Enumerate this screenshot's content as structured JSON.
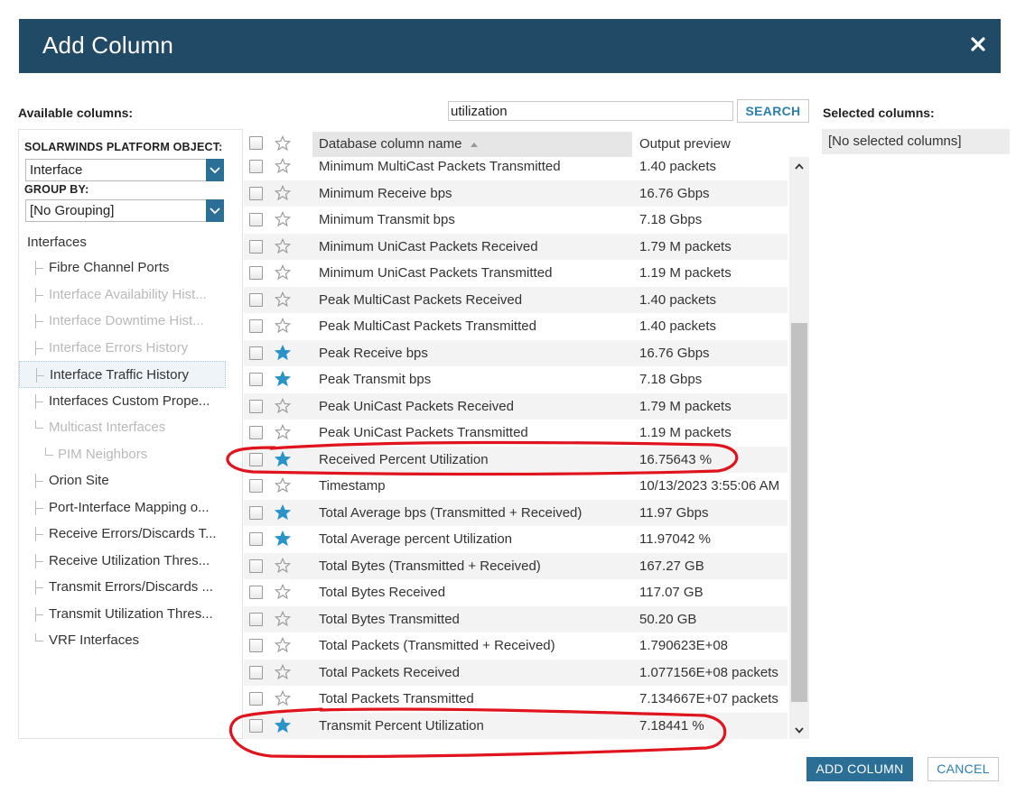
{
  "dialog": {
    "title": "Add Column",
    "close_icon": "close-icon"
  },
  "labels": {
    "available_columns": "Available columns:",
    "selected_columns": "Selected columns:",
    "platform_object": "SOLARWINDS PLATFORM OBJECT:",
    "group_by": "GROUP BY:"
  },
  "search": {
    "value": "utilization",
    "button_label": "SEARCH"
  },
  "selects": {
    "platform_object_value": "Interface",
    "group_by_value": "[No Grouping]"
  },
  "tree": {
    "root": "Interfaces",
    "items": [
      {
        "label": "Fibre Channel Ports",
        "dim": false
      },
      {
        "label": "Interface Availability Hist...",
        "dim": true
      },
      {
        "label": "Interface Downtime Hist...",
        "dim": true
      },
      {
        "label": "Interface Errors History",
        "dim": true
      },
      {
        "label": "Interface Traffic History",
        "dim": false,
        "selected": true
      },
      {
        "label": "Interfaces Custom Prope...",
        "dim": false
      },
      {
        "label": "Multicast Interfaces",
        "dim": true
      },
      {
        "label": "PIM Neighbors",
        "dim": true,
        "deep": true
      },
      {
        "label": "Orion Site",
        "dim": false
      },
      {
        "label": "Port-Interface Mapping o...",
        "dim": false
      },
      {
        "label": "Receive Errors/Discards T...",
        "dim": false
      },
      {
        "label": "Receive Utilization Thres...",
        "dim": false
      },
      {
        "label": "Transmit Errors/Discards ...",
        "dim": false
      },
      {
        "label": "Transmit Utilization Thres...",
        "dim": false
      },
      {
        "label": "VRF Interfaces",
        "dim": false
      }
    ]
  },
  "grid": {
    "headers": {
      "name": "Database column name",
      "preview": "Output preview"
    },
    "rows": [
      {
        "name": "Minimum MultiCast Packets Transmitted",
        "preview": "1.40 packets",
        "starred": false
      },
      {
        "name": "Minimum Receive bps",
        "preview": "16.76 Gbps",
        "starred": false
      },
      {
        "name": "Minimum Transmit bps",
        "preview": "7.18 Gbps",
        "starred": false
      },
      {
        "name": "Minimum UniCast Packets Received",
        "preview": "1.79 M packets",
        "starred": false
      },
      {
        "name": "Minimum UniCast Packets Transmitted",
        "preview": "1.19 M packets",
        "starred": false
      },
      {
        "name": "Peak MultiCast Packets Received",
        "preview": "1.40 packets",
        "starred": false
      },
      {
        "name": "Peak MultiCast Packets Transmitted",
        "preview": "1.40 packets",
        "starred": false
      },
      {
        "name": "Peak Receive bps",
        "preview": "16.76 Gbps",
        "starred": true
      },
      {
        "name": "Peak Transmit bps",
        "preview": "7.18 Gbps",
        "starred": true
      },
      {
        "name": "Peak UniCast Packets Received",
        "preview": "1.79 M packets",
        "starred": false
      },
      {
        "name": "Peak UniCast Packets Transmitted",
        "preview": "1.19 M packets",
        "starred": false
      },
      {
        "name": "Received Percent Utilization",
        "preview": "16.75643 %",
        "starred": true
      },
      {
        "name": "Timestamp",
        "preview": "10/13/2023 3:55:06 AM",
        "starred": false
      },
      {
        "name": "Total Average bps (Transmitted + Received)",
        "preview": "11.97 Gbps",
        "starred": true
      },
      {
        "name": "Total Average percent Utilization",
        "preview": "11.97042 %",
        "starred": true
      },
      {
        "name": "Total Bytes (Transmitted + Received)",
        "preview": "167.27 GB",
        "starred": false
      },
      {
        "name": "Total Bytes Received",
        "preview": "117.07 GB",
        "starred": false
      },
      {
        "name": "Total Bytes Transmitted",
        "preview": "50.20 GB",
        "starred": false
      },
      {
        "name": "Total Packets (Transmitted + Received)",
        "preview": "1.790623E+08",
        "starred": false
      },
      {
        "name": "Total Packets Received",
        "preview": "1.077156E+08 packets",
        "starred": false
      },
      {
        "name": "Total Packets Transmitted",
        "preview": "7.134667E+07 packets",
        "starred": false
      },
      {
        "name": "Transmit Percent Utilization",
        "preview": "7.18441 %",
        "starred": true
      }
    ]
  },
  "selected": {
    "empty_text": "[No selected columns]"
  },
  "footer": {
    "add_label": "ADD COLUMN",
    "cancel_label": "CANCEL"
  },
  "colors": {
    "header_bg": "#204a66",
    "accent": "#2c6f96",
    "star_filled": "#2a93c8",
    "annotation_red": "#e0141c"
  }
}
